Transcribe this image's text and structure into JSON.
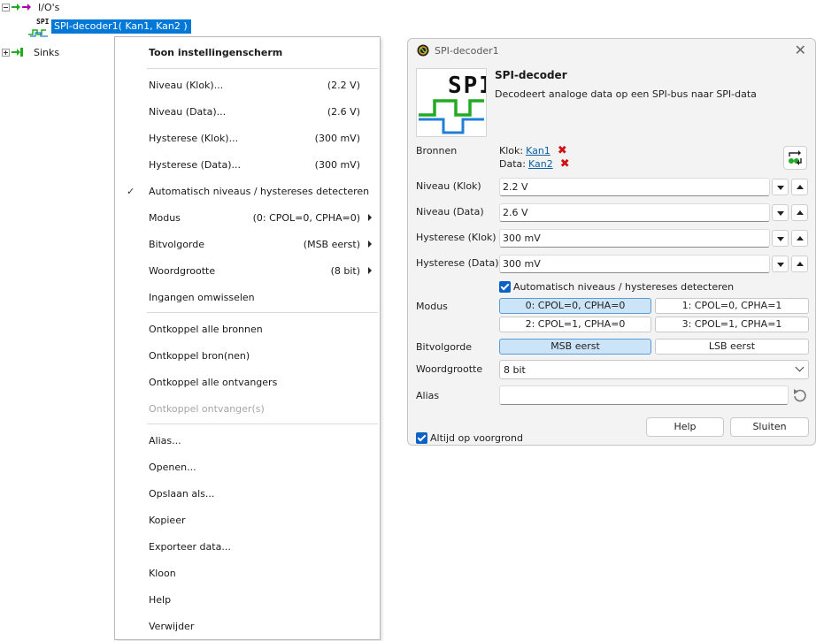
{
  "tree": {
    "ios_label": "I/O's",
    "selected_icon_text": "SPI",
    "selected_label": "SPI-decoder1( Kan1, Kan2 )",
    "sinks_label": "Sinks"
  },
  "menu": {
    "items": [
      {
        "label": "Toon instellingenscherm",
        "value": "",
        "bold": true
      },
      {
        "label": "Niveau (Klok)...",
        "value": "(2.2 V)"
      },
      {
        "label": "Niveau (Data)...",
        "value": "(2.6 V)"
      },
      {
        "label": "Hysterese (Klok)...",
        "value": "(300 mV)"
      },
      {
        "label": "Hysterese (Data)...",
        "value": "(300 mV)"
      },
      {
        "label": "Automatisch niveaus / hystereses detecteren",
        "value": "",
        "check": "✓"
      },
      {
        "label": "Modus",
        "value": "(0: CPOL=0, CPHA=0)",
        "submenu": true
      },
      {
        "label": "Bitvolgorde",
        "value": "(MSB eerst)",
        "submenu": true
      },
      {
        "label": "Woordgrootte",
        "value": "(8 bit)",
        "submenu": true
      },
      {
        "label": "Ingangen omwisselen",
        "value": ""
      },
      {
        "label": "Ontkoppel alle bronnen",
        "value": ""
      },
      {
        "label": "Ontkoppel bron(nen)",
        "value": ""
      },
      {
        "label": "Ontkoppel alle ontvangers",
        "value": ""
      },
      {
        "label": "Ontkoppel ontvanger(s)",
        "value": "",
        "disabled": true
      },
      {
        "label": "Alias...",
        "value": ""
      },
      {
        "label": "Openen...",
        "value": ""
      },
      {
        "label": "Opslaan als...",
        "value": ""
      },
      {
        "label": "Kopieer",
        "value": ""
      },
      {
        "label": "Exporteer data...",
        "value": ""
      },
      {
        "label": "Kloon",
        "value": ""
      },
      {
        "label": "Help",
        "value": ""
      },
      {
        "label": "Verwijder",
        "value": ""
      }
    ]
  },
  "dialog": {
    "title": "SPI-decoder1",
    "icon_text": "SPI",
    "device_name": "SPI-decoder",
    "device_desc": "Decodeert analoge data op een SPI-bus naar SPI-data",
    "sources_label": "Bronnen",
    "clock_label": "Klok:",
    "clock_link": "Kan1",
    "data_label": "Data:",
    "data_link": "Kan2",
    "remove_mark": "✖",
    "fields": [
      {
        "label": "Niveau (Klok)",
        "value": "2.2 V"
      },
      {
        "label": "Niveau (Data)",
        "value": "2.6 V"
      },
      {
        "label": "Hysterese (Klok)",
        "value": "300 mV"
      },
      {
        "label": "Hysterese (Data)",
        "value": "300 mV"
      }
    ],
    "auto_detect_label": "Automatisch niveaus / hystereses detecteren",
    "mode_label": "Modus",
    "modes": [
      "0: CPOL=0, CPHA=0",
      "1: CPOL=0, CPHA=1",
      "2: CPOL=1, CPHA=0",
      "3: CPOL=1, CPHA=1"
    ],
    "bitorder_label": "Bitvolgorde",
    "bitorders": [
      "MSB eerst",
      "LSB eerst"
    ],
    "wordsize_label": "Woordgrootte",
    "wordsize_value": "8 bit",
    "alias_label": "Alias",
    "alias_value": "",
    "always_on_top_label": "Altijd op voorgrond",
    "help_button": "Help",
    "close_button": "Sluiten",
    "close_glyph": "✕"
  },
  "colors": {
    "selection": "#0078d7",
    "link": "#0b61a4",
    "remove": "#d01010",
    "option_selected": "#cce4f7",
    "checkbox": "#0b61c4",
    "icon_green": "#22aa22",
    "icon_blue": "#1f7fd6"
  }
}
